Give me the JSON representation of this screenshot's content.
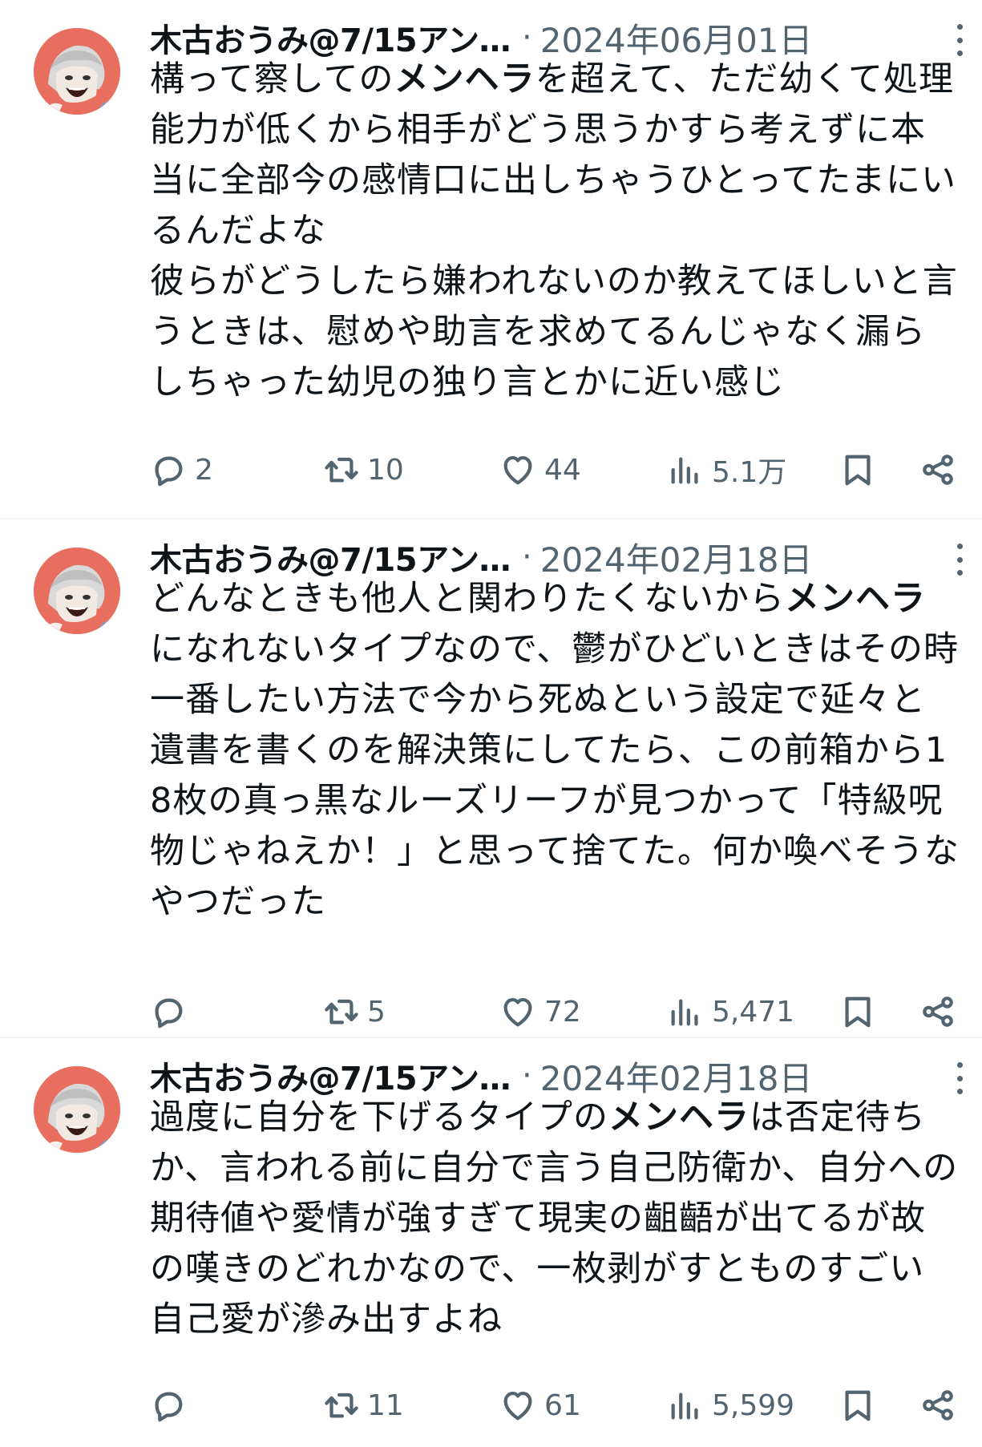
{
  "colors": {
    "text_primary": "#0f1419",
    "text_secondary": "#536471",
    "divider": "#eff3f4",
    "avatar_bg": "#e86f60"
  },
  "tweets": [
    {
      "author": "木古おうみ@7/15アン…",
      "separator": "·",
      "date": "2024年06月01日",
      "body_parts": [
        {
          "text": "構って察してのメンヘラを超えて、ただ幼くて処理能力が低くから相手がどう思うかすら考えずに本当に全部今の感情口に出しちゃうひとってたまにいるんだよな\n彼らがどうしたら嫌われないのか教えてほしいと言うときは、慰めや助言を求めてるんじゃなく漏らしちゃった幼児の独り言とかに近い感じ"
        }
      ],
      "highlight": "メンヘラ",
      "reply_count": "2",
      "retweet_count": "10",
      "like_count": "44",
      "view_count": "5.1万",
      "icons": [
        "reply-icon",
        "retweet-icon",
        "like-icon",
        "views-icon",
        "bookmark-icon",
        "share-icon"
      ]
    },
    {
      "author": "木古おうみ@7/15アン…",
      "separator": "·",
      "date": "2024年02月18日",
      "body_parts": [
        {
          "text": "どんなときも他人と関わりたくないからメンヘラになれないタイプなので、鬱がひどいときはその時一番したい方法で今から死ぬという設定で延々と遺書を書くのを解決策にしてたら、この前箱から18枚の真っ黒なルーズリーフが見つかって「特級呪物じゃねえか！」と思って捨てた。何か喚べそうなやつだった"
        }
      ],
      "highlight": "メンヘラ",
      "reply_count": "",
      "retweet_count": "5",
      "like_count": "72",
      "view_count": "5,471",
      "icons": [
        "reply-icon",
        "retweet-icon",
        "like-icon",
        "views-icon",
        "bookmark-icon",
        "share-icon"
      ]
    },
    {
      "author": "木古おうみ@7/15アン…",
      "separator": "·",
      "date": "2024年02月18日",
      "body_parts": [
        {
          "text": "過度に自分を下げるタイプのメンヘラは否定待ちか、言われる前に自分で言う自己防衛か、自分への期待値や愛情が強すぎて現実の齟齬が出てるが故の嘆きのどれかなので、一枚剥がすとものすごい自己愛が滲み出すよね"
        }
      ],
      "highlight": "メンヘラ",
      "reply_count": "",
      "retweet_count": "11",
      "like_count": "61",
      "view_count": "5,599",
      "icons": [
        "reply-icon",
        "retweet-icon",
        "like-icon",
        "views-icon",
        "bookmark-icon",
        "share-icon"
      ]
    }
  ]
}
